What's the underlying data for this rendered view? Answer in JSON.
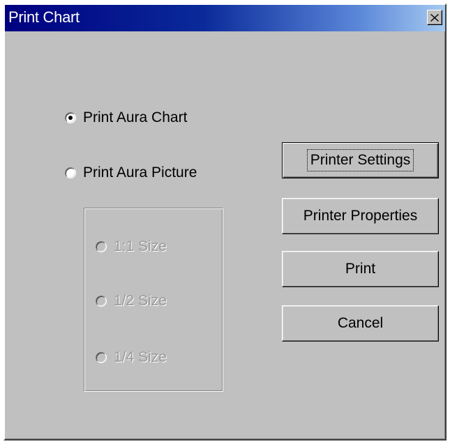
{
  "window": {
    "title": "Print Chart",
    "close_icon": "close-icon"
  },
  "print_mode": {
    "selected": "print_aura_chart",
    "options": [
      {
        "id": "print_aura_chart",
        "label": "Print Aura Chart",
        "checked": true
      },
      {
        "id": "print_aura_picture",
        "label": "Print Aura Picture",
        "checked": false
      }
    ]
  },
  "size_group": {
    "enabled": false,
    "options": [
      {
        "label": "1:1 Size",
        "checked": false
      },
      {
        "label": "1/2 Size",
        "checked": false
      },
      {
        "label": "1/4 Size",
        "checked": false
      }
    ]
  },
  "buttons": {
    "printer_settings": "Printer Settings",
    "printer_properties": "Printer Properties",
    "print": "Print",
    "cancel": "Cancel"
  },
  "colors": {
    "title_bar_start": "#000080",
    "title_bar_end": "#a6caf0",
    "dialog_face": "#c0c0c0",
    "disabled_text": "#9a9a9a"
  }
}
